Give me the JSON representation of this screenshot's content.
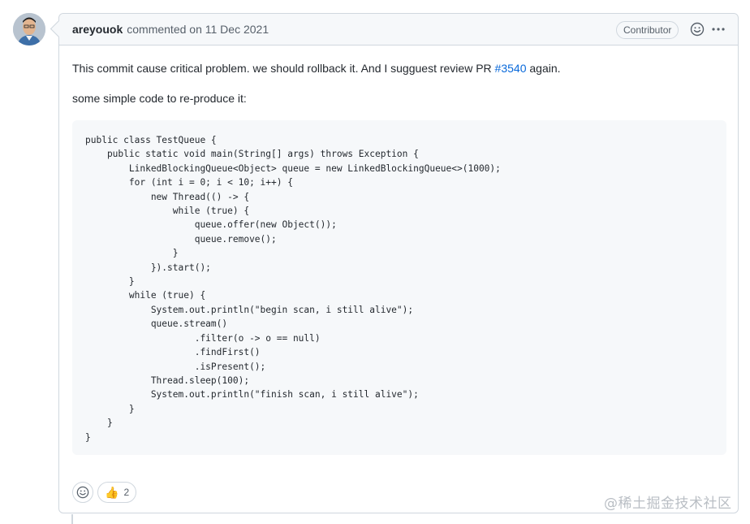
{
  "comment": {
    "author": "areyouok",
    "meta": "commented on 11 Dec 2021",
    "badge": "Contributor",
    "header_icons": [
      "smiley-icon",
      "kebab-horizontal-icon"
    ],
    "paragraph1_text": "This commit cause critical problem. we should rollback it. And I sugguest review PR ",
    "paragraph1_link": "#3540",
    "paragraph1_suffix": " again.",
    "paragraph2": "some simple code to re-produce it:",
    "code": "public class TestQueue {\n    public static void main(String[] args) throws Exception {\n        LinkedBlockingQueue<Object> queue = new LinkedBlockingQueue<>(1000);\n        for (int i = 0; i < 10; i++) {\n            new Thread(() -> {\n                while (true) {\n                    queue.offer(new Object());\n                    queue.remove();\n                }\n            }).start();\n        }\n        while (true) {\n            System.out.println(\"begin scan, i still alive\");\n            queue.stream()\n                    .filter(o -> o == null)\n                    .findFirst()\n                    .isPresent();\n            Thread.sleep(100);\n            System.out.println(\"finish scan, i still alive\");\n        }\n    }\n}"
  },
  "reactions": {
    "add_icon": "smiley-icon",
    "thumbs_up_emoji": "👍",
    "thumbs_up_count": "2"
  },
  "watermark": "@稀土掘金技术社区",
  "colors": {
    "link": "#0969da",
    "border": "#d0d7de",
    "header_bg": "#f6f8fa",
    "code_bg": "#f6f8fa"
  }
}
